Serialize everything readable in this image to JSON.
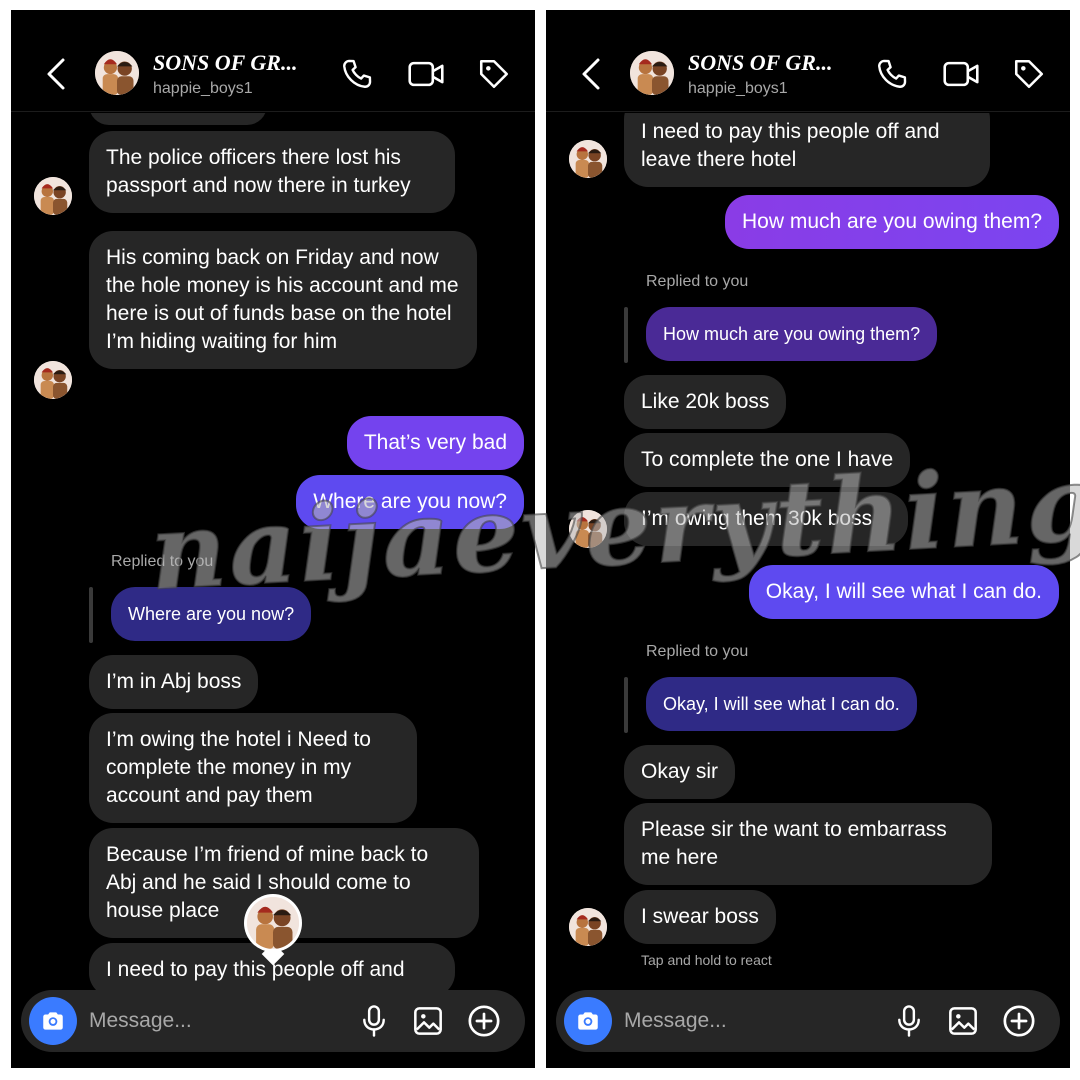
{
  "header": {
    "title": "SONS OF GR...",
    "subtitle": "happie_boys1",
    "icons": [
      "chevron-left-icon",
      "phone-icon",
      "video-camera-icon",
      "tag-icon"
    ]
  },
  "left_thread": {
    "messages": [
      {
        "side": "in",
        "text": "The police officers there lost his passport and now there in turkey"
      },
      {
        "side": "in",
        "text": "His coming back on Friday and now the hole money is his account and me here is out of funds base on the hotel I’m hiding waiting for him"
      },
      {
        "side": "out",
        "text": "That’s very bad"
      },
      {
        "side": "out",
        "text": "Where are you now?"
      },
      {
        "label": "Replied to you",
        "quoted": "Where are you now?"
      },
      {
        "side": "in",
        "text": "I’m in Abj boss"
      },
      {
        "side": "in",
        "text": "I’m owing the hotel i Need to complete the money in my account and pay them"
      },
      {
        "side": "in",
        "text": "Because I’m friend of mine back to Abj and he said I should come to house place"
      },
      {
        "side": "in",
        "text": "I need to pay this people off and"
      }
    ]
  },
  "right_thread": {
    "messages": [
      {
        "side": "in",
        "text": "I need to pay this people off and leave there hotel"
      },
      {
        "side": "out",
        "text": "How much are you owing them?"
      },
      {
        "label": "Replied to you",
        "quoted": "How much are you owing them?"
      },
      {
        "side": "in",
        "text": "Like 20k boss"
      },
      {
        "side": "in",
        "text": "To complete the one I have"
      },
      {
        "side": "in",
        "text": "I’m owing them 30k boss"
      },
      {
        "side": "out",
        "text": "Okay, I will see what I can do."
      },
      {
        "label": "Replied to you",
        "quoted": "Okay, I will see what I can do."
      },
      {
        "side": "in",
        "text": "Okay sir"
      },
      {
        "side": "in",
        "text": "Please sir the want to embarrass me here"
      },
      {
        "side": "in",
        "text": "I swear boss"
      }
    ],
    "hint": "Tap and hold to react"
  },
  "composer": {
    "placeholder": "Message...",
    "icons": [
      "camera-icon",
      "microphone-icon",
      "gallery-icon",
      "plus-circle-icon"
    ]
  },
  "watermark": "naijaeverything",
  "colors": {
    "background": "#000000",
    "incoming_bubble": "#262626",
    "outgoing_bubble_top": "#8a3ce6",
    "outgoing_bubble_bottom": "#5b47f0",
    "camera_button": "#3a7bff",
    "secondary_text": "#a8a8a8"
  }
}
